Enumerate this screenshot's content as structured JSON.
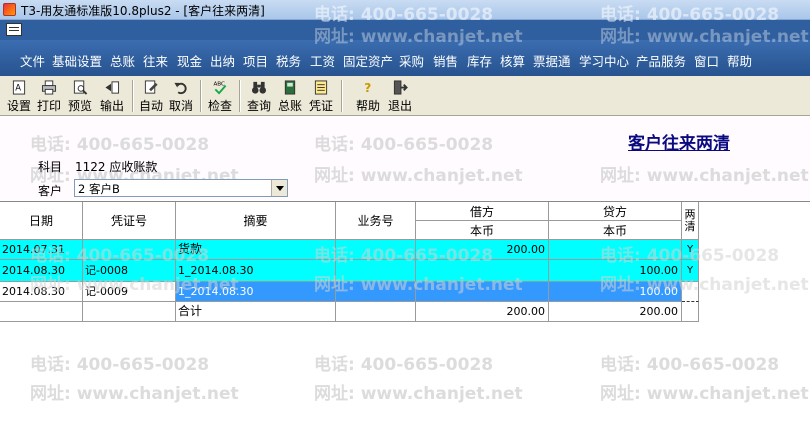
{
  "window": {
    "title": "T3-用友通标准版10.8plus2 - [客户往来两清]"
  },
  "menu": [
    "文件",
    "基础设置",
    "总账",
    "往来",
    "现金",
    "出纳",
    "项目",
    "税务",
    "工资",
    "固定资产",
    "采购",
    "销售",
    "库存",
    "核算",
    "票据通",
    "学习中心",
    "产品服务",
    "窗口",
    "帮助"
  ],
  "toolbar": {
    "settings": "设置",
    "print": "打印",
    "preview": "预览",
    "export": "输出",
    "auto": "自动",
    "cancel": "取消",
    "check": "检查",
    "query": "查询",
    "ledger": "总账",
    "voucher": "凭证",
    "help": "帮助",
    "exit": "退出"
  },
  "watermark": {
    "phone": "电话: 400-665-0028",
    "site": "网址: www.chanjet.net"
  },
  "report": {
    "title": "客户往来两清",
    "subject_label": "科目",
    "subject_value": "1122 应收账款",
    "customer_label": "客户",
    "customer_value": "2  客户B"
  },
  "table": {
    "headers": {
      "date": "日期",
      "voucher_no": "凭证号",
      "summary": "摘要",
      "business_no": "业务号",
      "debit": "借方",
      "credit": "贷方",
      "currency": "本币",
      "cleared": "两清"
    },
    "rows": [
      {
        "date": "2014.07.31",
        "voucher_no": "",
        "summary": "货款",
        "business_no": "",
        "debit": "200.00",
        "credit": "",
        "cleared": "Y"
      },
      {
        "date": "2014.08.30",
        "voucher_no": "记-0008",
        "summary": "1_2014.08.30",
        "business_no": "",
        "debit": "",
        "credit": "100.00",
        "cleared": "Y"
      },
      {
        "date": "2014.08.30",
        "voucher_no": "记-0009",
        "summary": "1_2014.08.30",
        "business_no": "",
        "debit": "",
        "credit": "100.00",
        "cleared": ""
      }
    ],
    "total": {
      "label": "合计",
      "debit": "200.00",
      "credit": "200.00"
    }
  }
}
